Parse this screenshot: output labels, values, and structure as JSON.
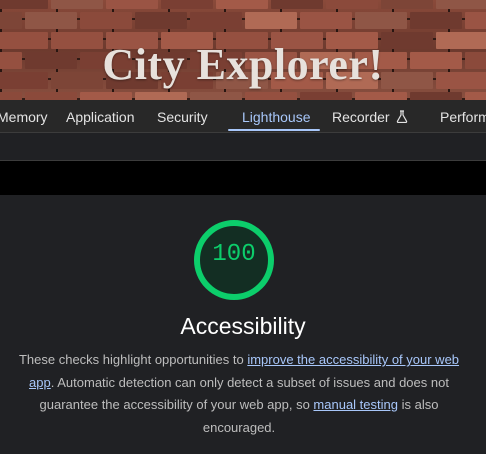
{
  "banner": {
    "title": "City Explorer!"
  },
  "devtools": {
    "tabs": [
      {
        "label": "Memory"
      },
      {
        "label": "Application"
      },
      {
        "label": "Security"
      },
      {
        "label": "Lighthouse"
      },
      {
        "label": "Recorder"
      },
      {
        "label": "Perform"
      }
    ],
    "active_tab": "Lighthouse"
  },
  "report": {
    "score": "100",
    "category": "Accessibility",
    "description": {
      "part1": "These checks highlight opportunities to ",
      "link1": "improve the accessibility of your web app",
      "part2": ". Automatic detection can only detect a subset of issues and does not guarantee the accessibility of your web app, so ",
      "link2": "manual testing",
      "part3": " is also encouraged."
    }
  },
  "colors": {
    "pass_green": "#0cce6b",
    "link_blue": "#a8c7fa",
    "panel_bg": "#202124"
  }
}
